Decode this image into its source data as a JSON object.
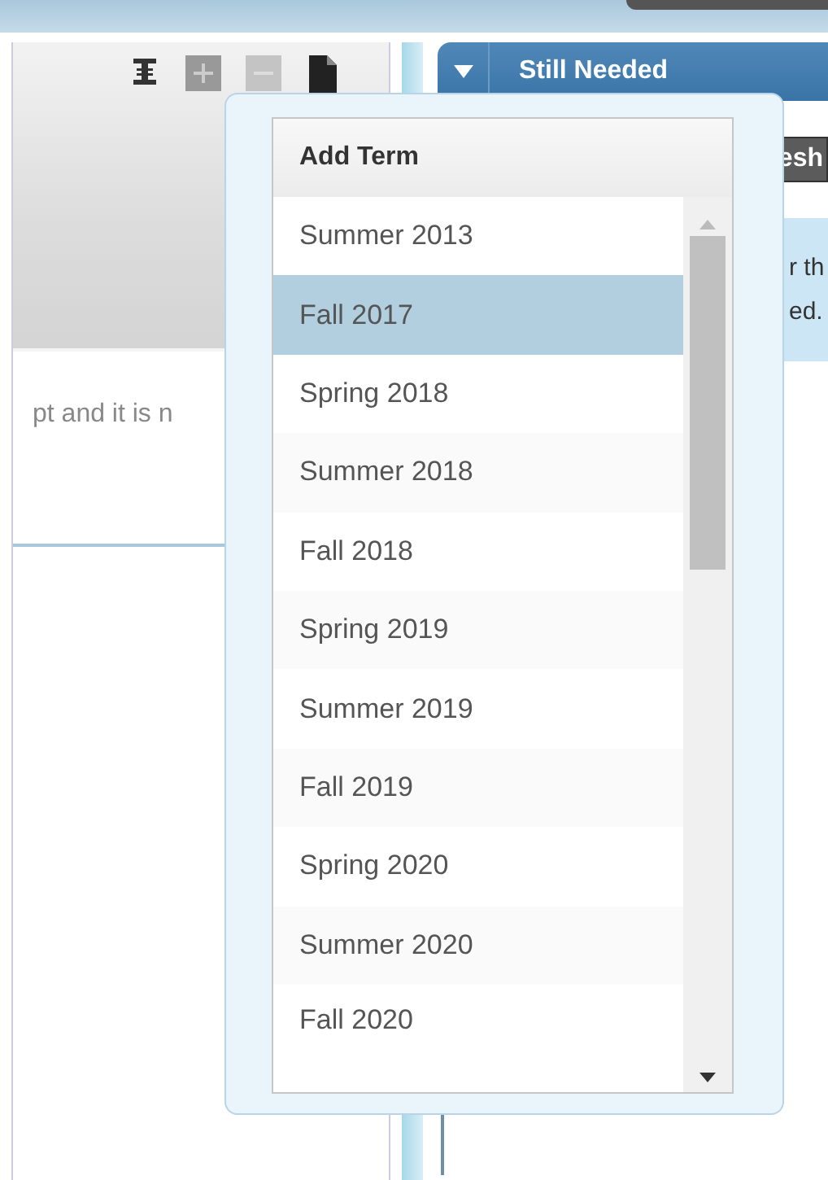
{
  "left_panel": {
    "text": "pt and it is n"
  },
  "right_panel": {
    "title": "Still Needed",
    "button": "esh",
    "text_lines": [
      "r th",
      "ed."
    ]
  },
  "term_menu": {
    "title": "Add Term",
    "items": [
      {
        "label": "Summer 2013",
        "selected": false
      },
      {
        "label": "Fall 2017",
        "selected": true
      },
      {
        "label": "Spring 2018",
        "selected": false
      },
      {
        "label": "Summer 2018",
        "selected": false
      },
      {
        "label": "Fall 2018",
        "selected": false
      },
      {
        "label": "Spring 2019",
        "selected": false
      },
      {
        "label": "Summer 2019",
        "selected": false
      },
      {
        "label": "Fall 2019",
        "selected": false
      },
      {
        "label": "Spring 2020",
        "selected": false
      },
      {
        "label": "Summer 2020",
        "selected": false
      },
      {
        "label": "Fall 2020",
        "selected": false
      }
    ]
  }
}
